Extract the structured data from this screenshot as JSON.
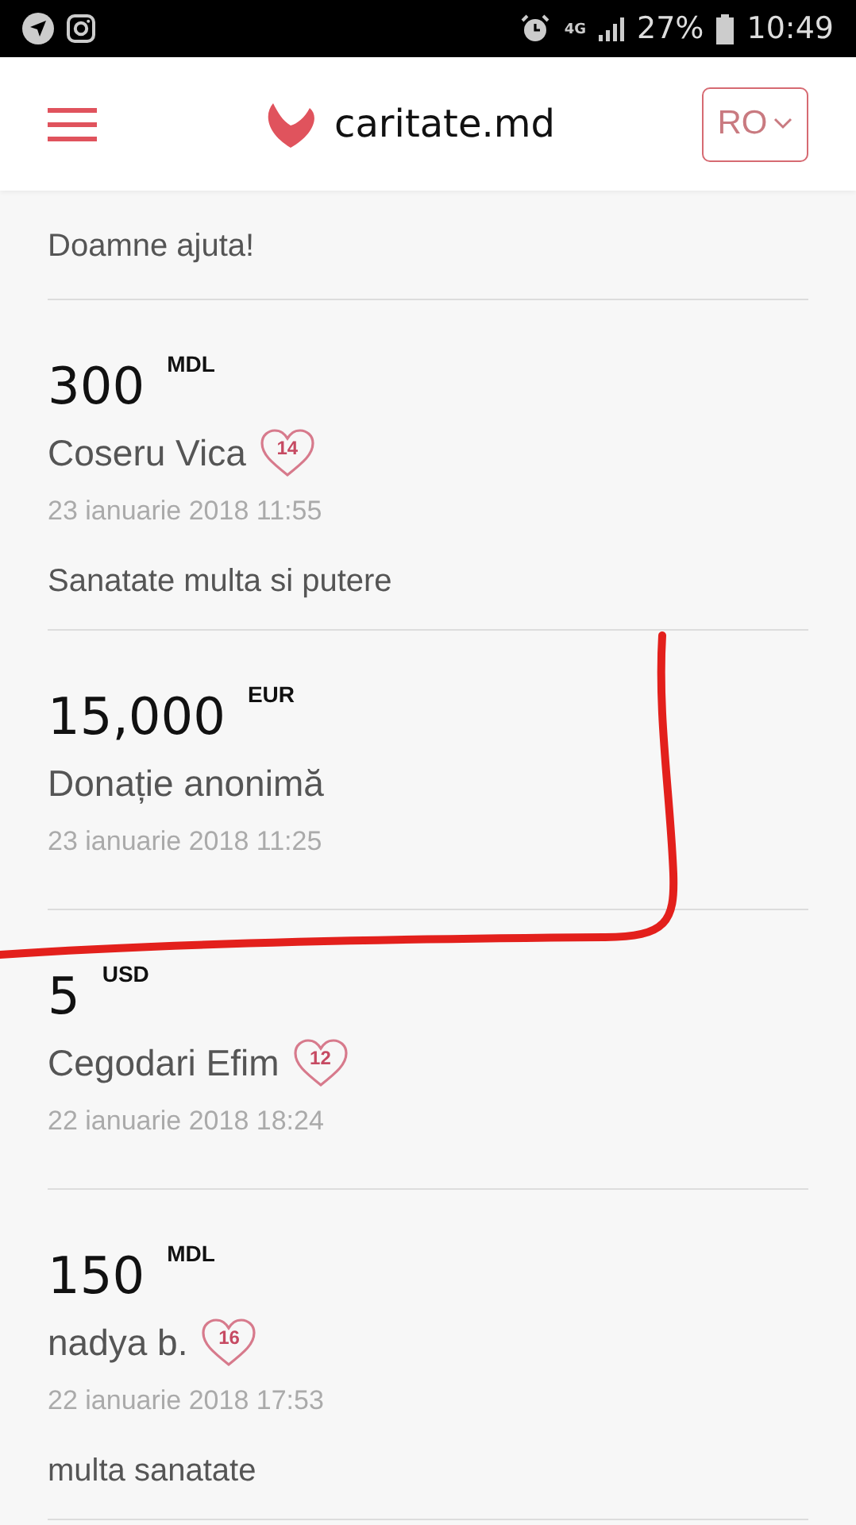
{
  "status_bar": {
    "network": "4G",
    "battery": "27%",
    "time": "10:49"
  },
  "header": {
    "logo_text": "caritate.md",
    "language": "RO"
  },
  "feed": [
    {
      "kind": "message",
      "message": "Doamne ajuta!"
    },
    {
      "kind": "donation",
      "amount": "300",
      "currency": "MDL",
      "donor": "Coseru Vica",
      "badge": "14",
      "date": "23 ianuarie 2018 11:55",
      "message": "Sanatate multa si putere"
    },
    {
      "kind": "donation",
      "amount": "15,000",
      "currency": "EUR",
      "donor": "Donație anonimă",
      "date": "23 ianuarie 2018 11:25"
    },
    {
      "kind": "donation",
      "amount": "5",
      "currency": "USD",
      "donor": "Cegodari Efim",
      "badge": "12",
      "date": "22 ianuarie 2018 18:24"
    },
    {
      "kind": "donation",
      "amount": "150",
      "currency": "MDL",
      "donor": "nadya b.",
      "badge": "16",
      "date": "22 ianuarie 2018 17:53",
      "message": "multa sanatate"
    }
  ],
  "markup": {
    "kind": "pen-stroke"
  }
}
